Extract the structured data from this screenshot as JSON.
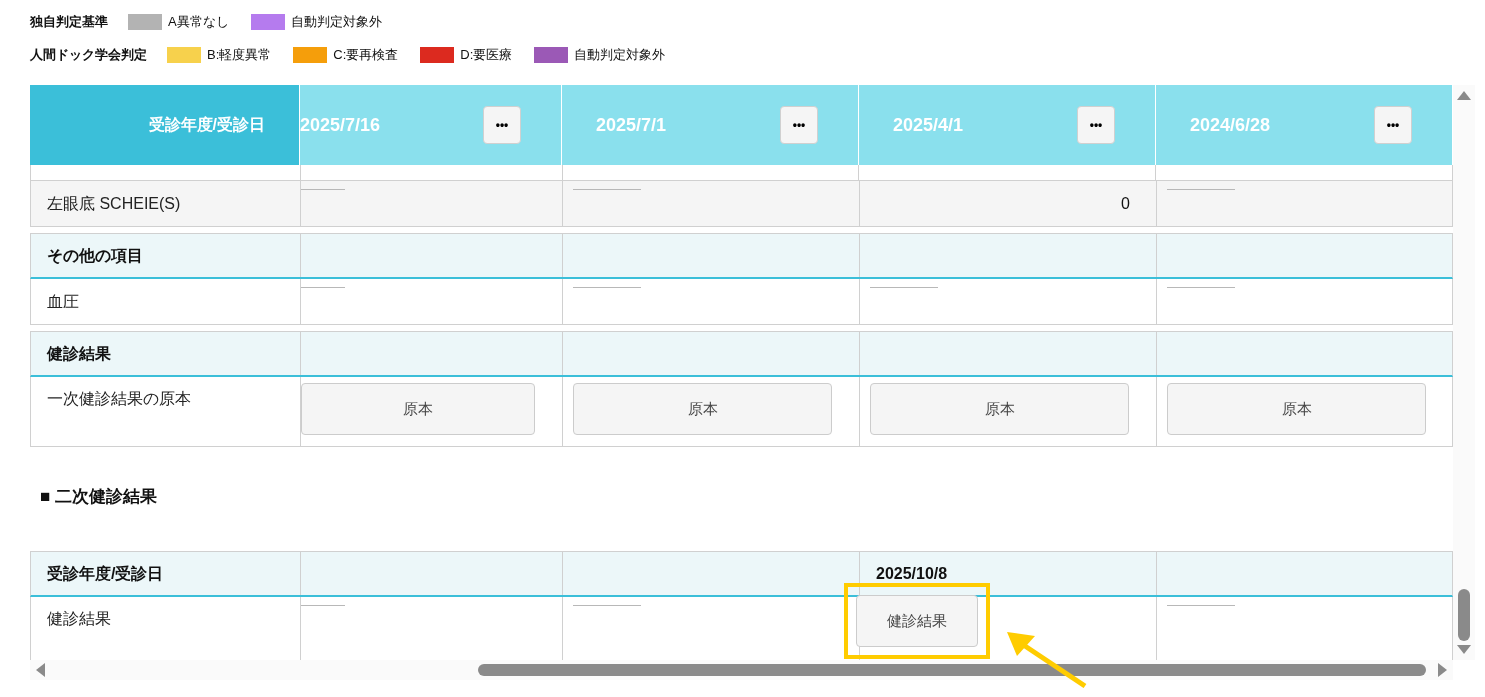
{
  "legend": [
    {
      "title": "独自判定基準",
      "items": [
        {
          "label": "A異常なし",
          "color": "#b3b3b3"
        },
        {
          "label": "自動判定対象外",
          "color": "#b57bee"
        }
      ]
    },
    {
      "title": "人間ドック学会判定",
      "items": [
        {
          "label": "B:軽度異常",
          "color": "#f7d14c"
        },
        {
          "label": "C:要再検査",
          "color": "#f59e0b"
        },
        {
          "label": "D:要医療",
          "color": "#dc2a1f"
        },
        {
          "label": "自動判定対象外",
          "color": "#9b59b6"
        }
      ]
    }
  ],
  "main_table": {
    "header_label": "受診年度/受診日",
    "columns": [
      {
        "date": "2025/7/16",
        "menu": "•••"
      },
      {
        "date": "2025/7/1",
        "menu": "•••"
      },
      {
        "date": "2025/4/1",
        "menu": "•••"
      },
      {
        "date": "2024/6/28",
        "menu": "•••"
      }
    ],
    "rows": [
      {
        "kind": "striped",
        "label": "左眼底 SCHEIE(S)",
        "cells": [
          {
            "kind": "empty"
          },
          {
            "kind": "empty"
          },
          {
            "kind": "value",
            "text": "0"
          },
          {
            "kind": "empty"
          }
        ]
      },
      {
        "kind": "section",
        "label": "その他の項目"
      },
      {
        "kind": "row",
        "label": "血圧",
        "cells": [
          {
            "kind": "empty"
          },
          {
            "kind": "empty"
          },
          {
            "kind": "empty"
          },
          {
            "kind": "empty"
          }
        ]
      },
      {
        "kind": "section",
        "label": "健診結果"
      },
      {
        "kind": "row",
        "label": "一次健診結果の原本",
        "cells": [
          {
            "kind": "button",
            "text": "原本",
            "highlighted": false
          },
          {
            "kind": "button",
            "text": "原本",
            "highlighted": false
          },
          {
            "kind": "button",
            "text": "原本",
            "highlighted": false
          },
          {
            "kind": "button",
            "text": "原本",
            "highlighted": false
          }
        ]
      }
    ]
  },
  "second_heading": "■ 二次健診結果",
  "second_table": {
    "rows": [
      {
        "kind": "section",
        "label": "受診年度/受診日",
        "cells": [
          {
            "kind": "blank"
          },
          {
            "kind": "blank"
          },
          {
            "kind": "value",
            "text": "2025/10/8"
          },
          {
            "kind": "blank"
          }
        ]
      },
      {
        "kind": "row",
        "label": "健診結果",
        "cells": [
          {
            "kind": "empty"
          },
          {
            "kind": "empty"
          },
          {
            "kind": "button",
            "text": "健診結果",
            "highlighted": true
          },
          {
            "kind": "empty"
          }
        ]
      }
    ]
  }
}
